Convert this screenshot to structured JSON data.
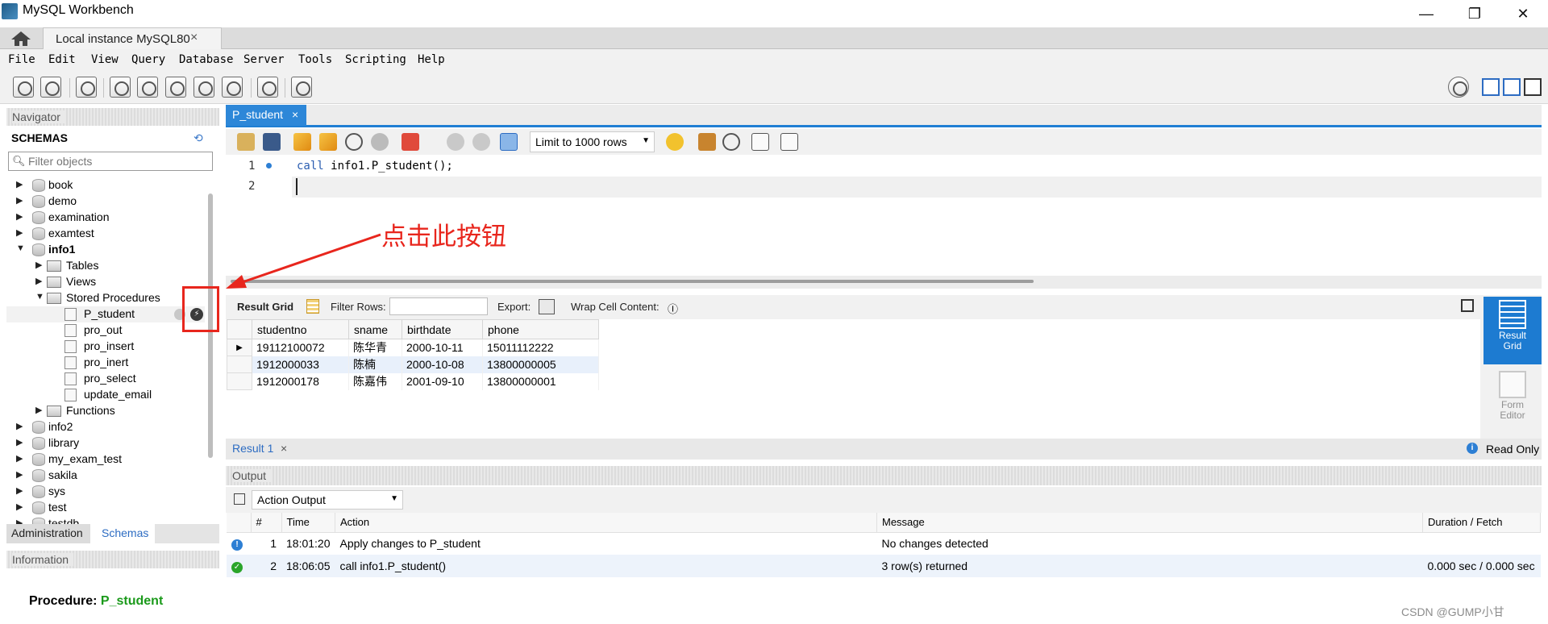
{
  "window": {
    "title": "MySQL Workbench",
    "minimize": "—",
    "restore": "❐",
    "close": "✕"
  },
  "connection_tab": {
    "label": "Local instance MySQL80",
    "close": "×"
  },
  "menu": [
    "File",
    "Edit",
    "View",
    "Query",
    "Database",
    "Server",
    "Tools",
    "Scripting",
    "Help"
  ],
  "navigator": {
    "header": "Navigator",
    "schemas_label": "SCHEMAS",
    "filter_placeholder": "Filter objects",
    "tree": [
      {
        "label": "book",
        "level": 0,
        "arrow": "▶",
        "kind": "db"
      },
      {
        "label": "demo",
        "level": 0,
        "arrow": "▶",
        "kind": "db"
      },
      {
        "label": "examination",
        "level": 0,
        "arrow": "▶",
        "kind": "db"
      },
      {
        "label": "examtest",
        "level": 0,
        "arrow": "▶",
        "kind": "db"
      },
      {
        "label": "info1",
        "level": 0,
        "arrow": "▼",
        "kind": "db",
        "bold": true
      },
      {
        "label": "Tables",
        "level": 1,
        "arrow": "▶",
        "kind": "folder"
      },
      {
        "label": "Views",
        "level": 1,
        "arrow": "▶",
        "kind": "folder"
      },
      {
        "label": "Stored Procedures",
        "level": 1,
        "arrow": "▼",
        "kind": "folder"
      },
      {
        "label": "P_student",
        "level": 2,
        "arrow": "",
        "kind": "proc"
      },
      {
        "label": "pro_out",
        "level": 2,
        "arrow": "",
        "kind": "proc"
      },
      {
        "label": "pro_insert",
        "level": 2,
        "arrow": "",
        "kind": "proc"
      },
      {
        "label": "pro_inert",
        "level": 2,
        "arrow": "",
        "kind": "proc"
      },
      {
        "label": "pro_select",
        "level": 2,
        "arrow": "",
        "kind": "proc"
      },
      {
        "label": "update_email",
        "level": 2,
        "arrow": "",
        "kind": "proc"
      },
      {
        "label": "Functions",
        "level": 1,
        "arrow": "▶",
        "kind": "folder"
      },
      {
        "label": "info2",
        "level": 0,
        "arrow": "▶",
        "kind": "db"
      },
      {
        "label": "library",
        "level": 0,
        "arrow": "▶",
        "kind": "db"
      },
      {
        "label": "my_exam_test",
        "level": 0,
        "arrow": "▶",
        "kind": "db"
      },
      {
        "label": "sakila",
        "level": 0,
        "arrow": "▶",
        "kind": "db"
      },
      {
        "label": "sys",
        "level": 0,
        "arrow": "▶",
        "kind": "db"
      },
      {
        "label": "test",
        "level": 0,
        "arrow": "▶",
        "kind": "db"
      },
      {
        "label": "testdb",
        "level": 0,
        "arrow": "▶",
        "kind": "db"
      }
    ],
    "tabs": {
      "administration": "Administration",
      "schemas": "Schemas"
    },
    "info_header": "Information",
    "procedure_label": "Procedure:",
    "procedure_name": "P_student"
  },
  "query_tab": {
    "label": "P_student",
    "close": "×"
  },
  "limit_select": "Limit to 1000 rows",
  "editor": {
    "line_numbers": [
      "1",
      "2"
    ],
    "keyword": "call",
    "statement": " info1.P_student();"
  },
  "annotation": "点击此按钮",
  "result_toolbar": {
    "result_grid": "Result Grid",
    "filter_rows": "Filter Rows:",
    "export": "Export:",
    "wrap": "Wrap Cell Content:"
  },
  "result_grid": {
    "columns": [
      "studentno",
      "sname",
      "birthdate",
      "phone"
    ],
    "rows": [
      [
        "19112100072",
        "陈华青",
        "2000-10-11",
        "15011112222"
      ],
      [
        "1912000033",
        "陈楠",
        "2000-10-08",
        "13800000005"
      ],
      [
        "1912000178",
        "陈嘉伟",
        "2001-09-10",
        "13800000001"
      ]
    ]
  },
  "side_panel": {
    "result_grid": "Result Grid",
    "form_editor": "Form Editor"
  },
  "result_tab": {
    "label": "Result 1",
    "close": "×",
    "read_only": "Read Only"
  },
  "output": {
    "header": "Output",
    "select": "Action Output",
    "columns": [
      "",
      "#",
      "Time",
      "Action",
      "Message",
      "Duration / Fetch"
    ],
    "rows": [
      {
        "status": "info",
        "num": "1",
        "time": "18:01:20",
        "action": "Apply changes to P_student",
        "message": "No changes detected",
        "duration": ""
      },
      {
        "status": "ok",
        "num": "2",
        "time": "18:06:05",
        "action": "call info1.P_student()",
        "message": "3 row(s) returned",
        "duration": "0.000 sec / 0.000 sec"
      }
    ]
  },
  "watermark": "CSDN @GUMP小甘",
  "colors": {
    "accent": "#1d7bd1",
    "annotation": "#e8261d",
    "procedure": "#1b9a1b"
  }
}
